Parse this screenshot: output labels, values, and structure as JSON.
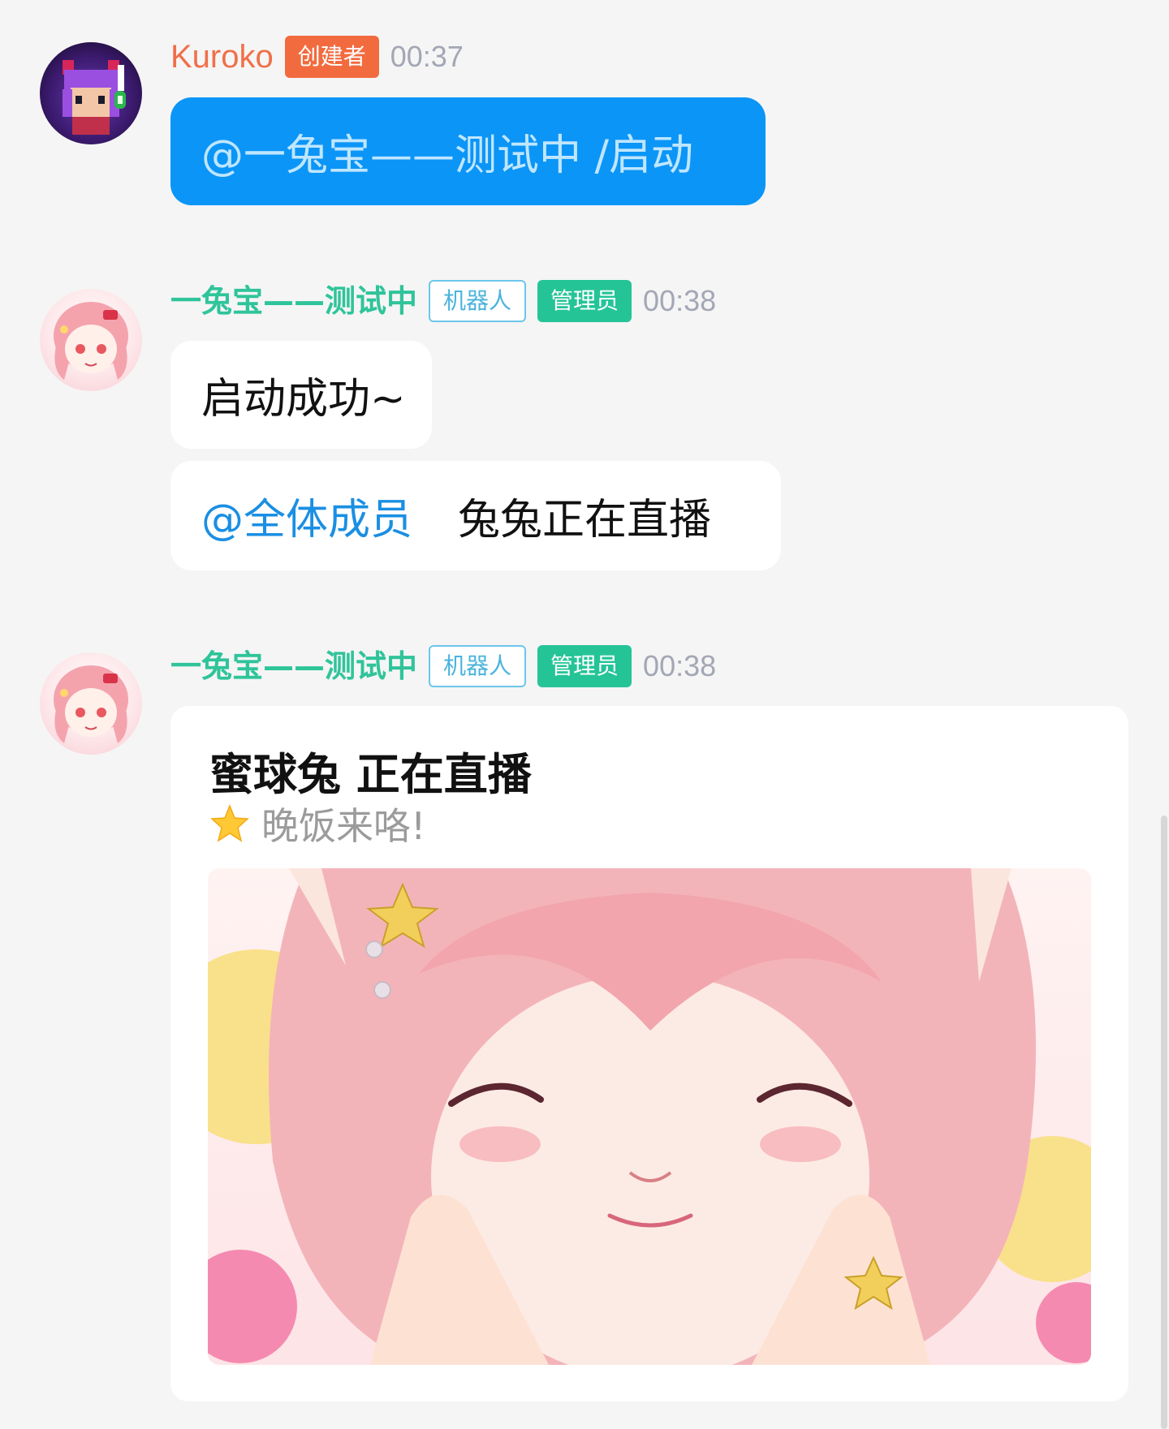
{
  "messages": [
    {
      "sender": "Kuroko",
      "badges": [
        "创建者"
      ],
      "time": "00:37",
      "bubbles": [
        {
          "text": "@一兔宝——测试中 /启动"
        }
      ]
    },
    {
      "sender": "一兔宝——测试中",
      "badges": [
        "机器人",
        "管理员"
      ],
      "time": "00:38",
      "bubbles": [
        {
          "text": "启动成功~"
        },
        {
          "mention": "@全体成员",
          "text": "兔兔正在直播"
        }
      ]
    },
    {
      "sender": "一兔宝——测试中",
      "badges": [
        "机器人",
        "管理员"
      ],
      "time": "00:38",
      "card": {
        "title": "蜜球兔 正在直播",
        "subtitle": "晚饭来咯!",
        "subtitle_icon": "star-emoji",
        "image": "anime-girl-live-cover"
      }
    }
  ],
  "colors": {
    "background": "#f5f5f5",
    "creator_name": "#f07049",
    "bot_name": "#2fc49a",
    "creator_badge": "#f26b3f",
    "robot_badge_border": "#6cc6ea",
    "admin_badge": "#25c497",
    "blue_bubble": "#0b95f7",
    "mention": "#1a8fe3",
    "time": "#a3a7b5"
  }
}
